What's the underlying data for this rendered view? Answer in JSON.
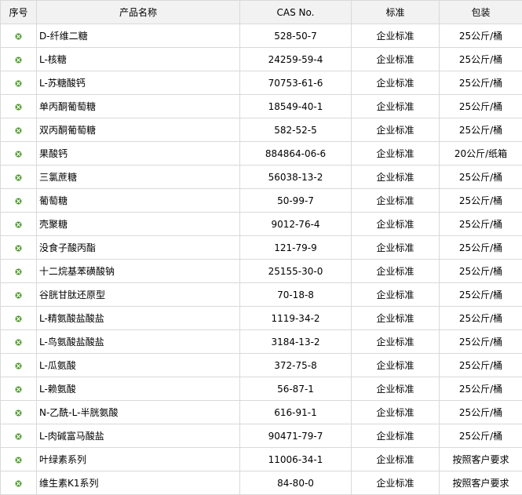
{
  "table": {
    "headers": [
      "序号",
      "产品名称",
      "CAS No.",
      "标准",
      "包装"
    ],
    "bullet_icon": "circle-check-icon",
    "bullet_color": "#4d9a2a",
    "rows": [
      {
        "name": "D-纤维二糖",
        "cas": "528-50-7",
        "standard": "企业标准",
        "packaging": "25公斤/桶"
      },
      {
        "name": "L-核糖",
        "cas": "24259-59-4",
        "standard": "企业标准",
        "packaging": "25公斤/桶"
      },
      {
        "name": "L-苏糖酸钙",
        "cas": "70753-61-6",
        "standard": "企业标准",
        "packaging": "25公斤/桶"
      },
      {
        "name": "单丙酮葡萄糖",
        "cas": "18549-40-1",
        "standard": "企业标准",
        "packaging": "25公斤/桶"
      },
      {
        "name": "双丙酮葡萄糖",
        "cas": "582-52-5",
        "standard": "企业标准",
        "packaging": "25公斤/桶"
      },
      {
        "name": "果酸钙",
        "cas": "884864-06-6",
        "standard": "企业标准",
        "packaging": "20公斤/纸箱"
      },
      {
        "name": "三氯蔗糖",
        "cas": "56038-13-2",
        "standard": "企业标准",
        "packaging": "25公斤/桶"
      },
      {
        "name": "葡萄糖",
        "cas": "50-99-7",
        "standard": "企业标准",
        "packaging": "25公斤/桶"
      },
      {
        "name": "壳聚糖",
        "cas": "9012-76-4",
        "standard": "企业标准",
        "packaging": "25公斤/桶"
      },
      {
        "name": "没食子酸丙酯",
        "cas": "121-79-9",
        "standard": "企业标准",
        "packaging": "25公斤/桶"
      },
      {
        "name": "十二烷基苯磺酸钠",
        "cas": "25155-30-0",
        "standard": "企业标准",
        "packaging": "25公斤/桶"
      },
      {
        "name": "谷胱甘肽还原型",
        "cas": "70-18-8",
        "standard": "企业标准",
        "packaging": "25公斤/桶"
      },
      {
        "name": "L-精氨酸盐酸盐",
        "cas": "1119-34-2",
        "standard": "企业标准",
        "packaging": "25公斤/桶"
      },
      {
        "name": "L-鸟氨酸盐酸盐",
        "cas": "3184-13-2",
        "standard": "企业标准",
        "packaging": "25公斤/桶"
      },
      {
        "name": "L-瓜氨酸",
        "cas": "372-75-8",
        "standard": "企业标准",
        "packaging": "25公斤/桶"
      },
      {
        "name": "L-赖氨酸",
        "cas": "56-87-1",
        "standard": "企业标准",
        "packaging": "25公斤/桶"
      },
      {
        "name": "N-乙酰-L-半胱氨酸",
        "cas": "616-91-1",
        "standard": "企业标准",
        "packaging": "25公斤/桶"
      },
      {
        "name": "L-肉碱富马酸盐",
        "cas": "90471-79-7",
        "standard": "企业标准",
        "packaging": "25公斤/桶"
      },
      {
        "name": "叶绿素系列",
        "cas": "11006-34-1",
        "standard": "企业标准",
        "packaging": "按照客户要求"
      },
      {
        "name": "维生素K1系列",
        "cas": "84-80-0",
        "standard": "企业标准",
        "packaging": "按照客户要求"
      }
    ]
  }
}
